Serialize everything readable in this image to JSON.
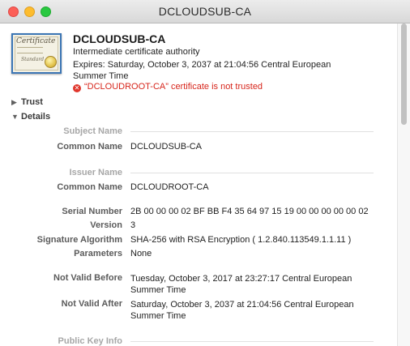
{
  "window": {
    "title": "DCLOUDSUB-CA"
  },
  "certificate": {
    "name": "DCLOUDSUB-CA",
    "type": "Intermediate certificate authority",
    "expires": "Expires: Saturday, October 3, 2037 at 21:04:56 Central European Summer Time",
    "trust_warning": "“DCLOUDROOT-CA” certificate is not trusted",
    "icon_text": "Certificate",
    "icon_subtext": "Standard"
  },
  "sections": {
    "trust": "Trust",
    "details": "Details"
  },
  "subject": {
    "group_label": "Subject Name",
    "common_name_label": "Common Name",
    "common_name_value": "DCLOUDSUB-CA"
  },
  "issuer": {
    "group_label": "Issuer Name",
    "common_name_label": "Common Name",
    "common_name_value": "DCLOUDROOT-CA"
  },
  "fields": {
    "serial_label": "Serial Number",
    "serial_value": "2B 00 00 00 02 BF BB F4 35 64 97 15 19 00 00 00 00 00 02",
    "version_label": "Version",
    "version_value": "3",
    "sigalg_label": "Signature Algorithm",
    "sigalg_value": "SHA-256 with RSA Encryption ( 1.2.840.113549.1.1.11 )",
    "params_label": "Parameters",
    "params_value": "None",
    "not_before_label": "Not Valid Before",
    "not_before_value": "Tuesday, October 3, 2017 at 23:27:17 Central European Summer Time",
    "not_after_label": "Not Valid After",
    "not_after_value": "Saturday, October 3, 2037 at 21:04:56 Central European Summer Time"
  },
  "public_key": {
    "group_label": "Public Key Info"
  },
  "colors": {
    "warning": "#d7261c",
    "close": "#fc5f57",
    "minimize": "#fdbc2e",
    "maximize": "#29c840"
  }
}
